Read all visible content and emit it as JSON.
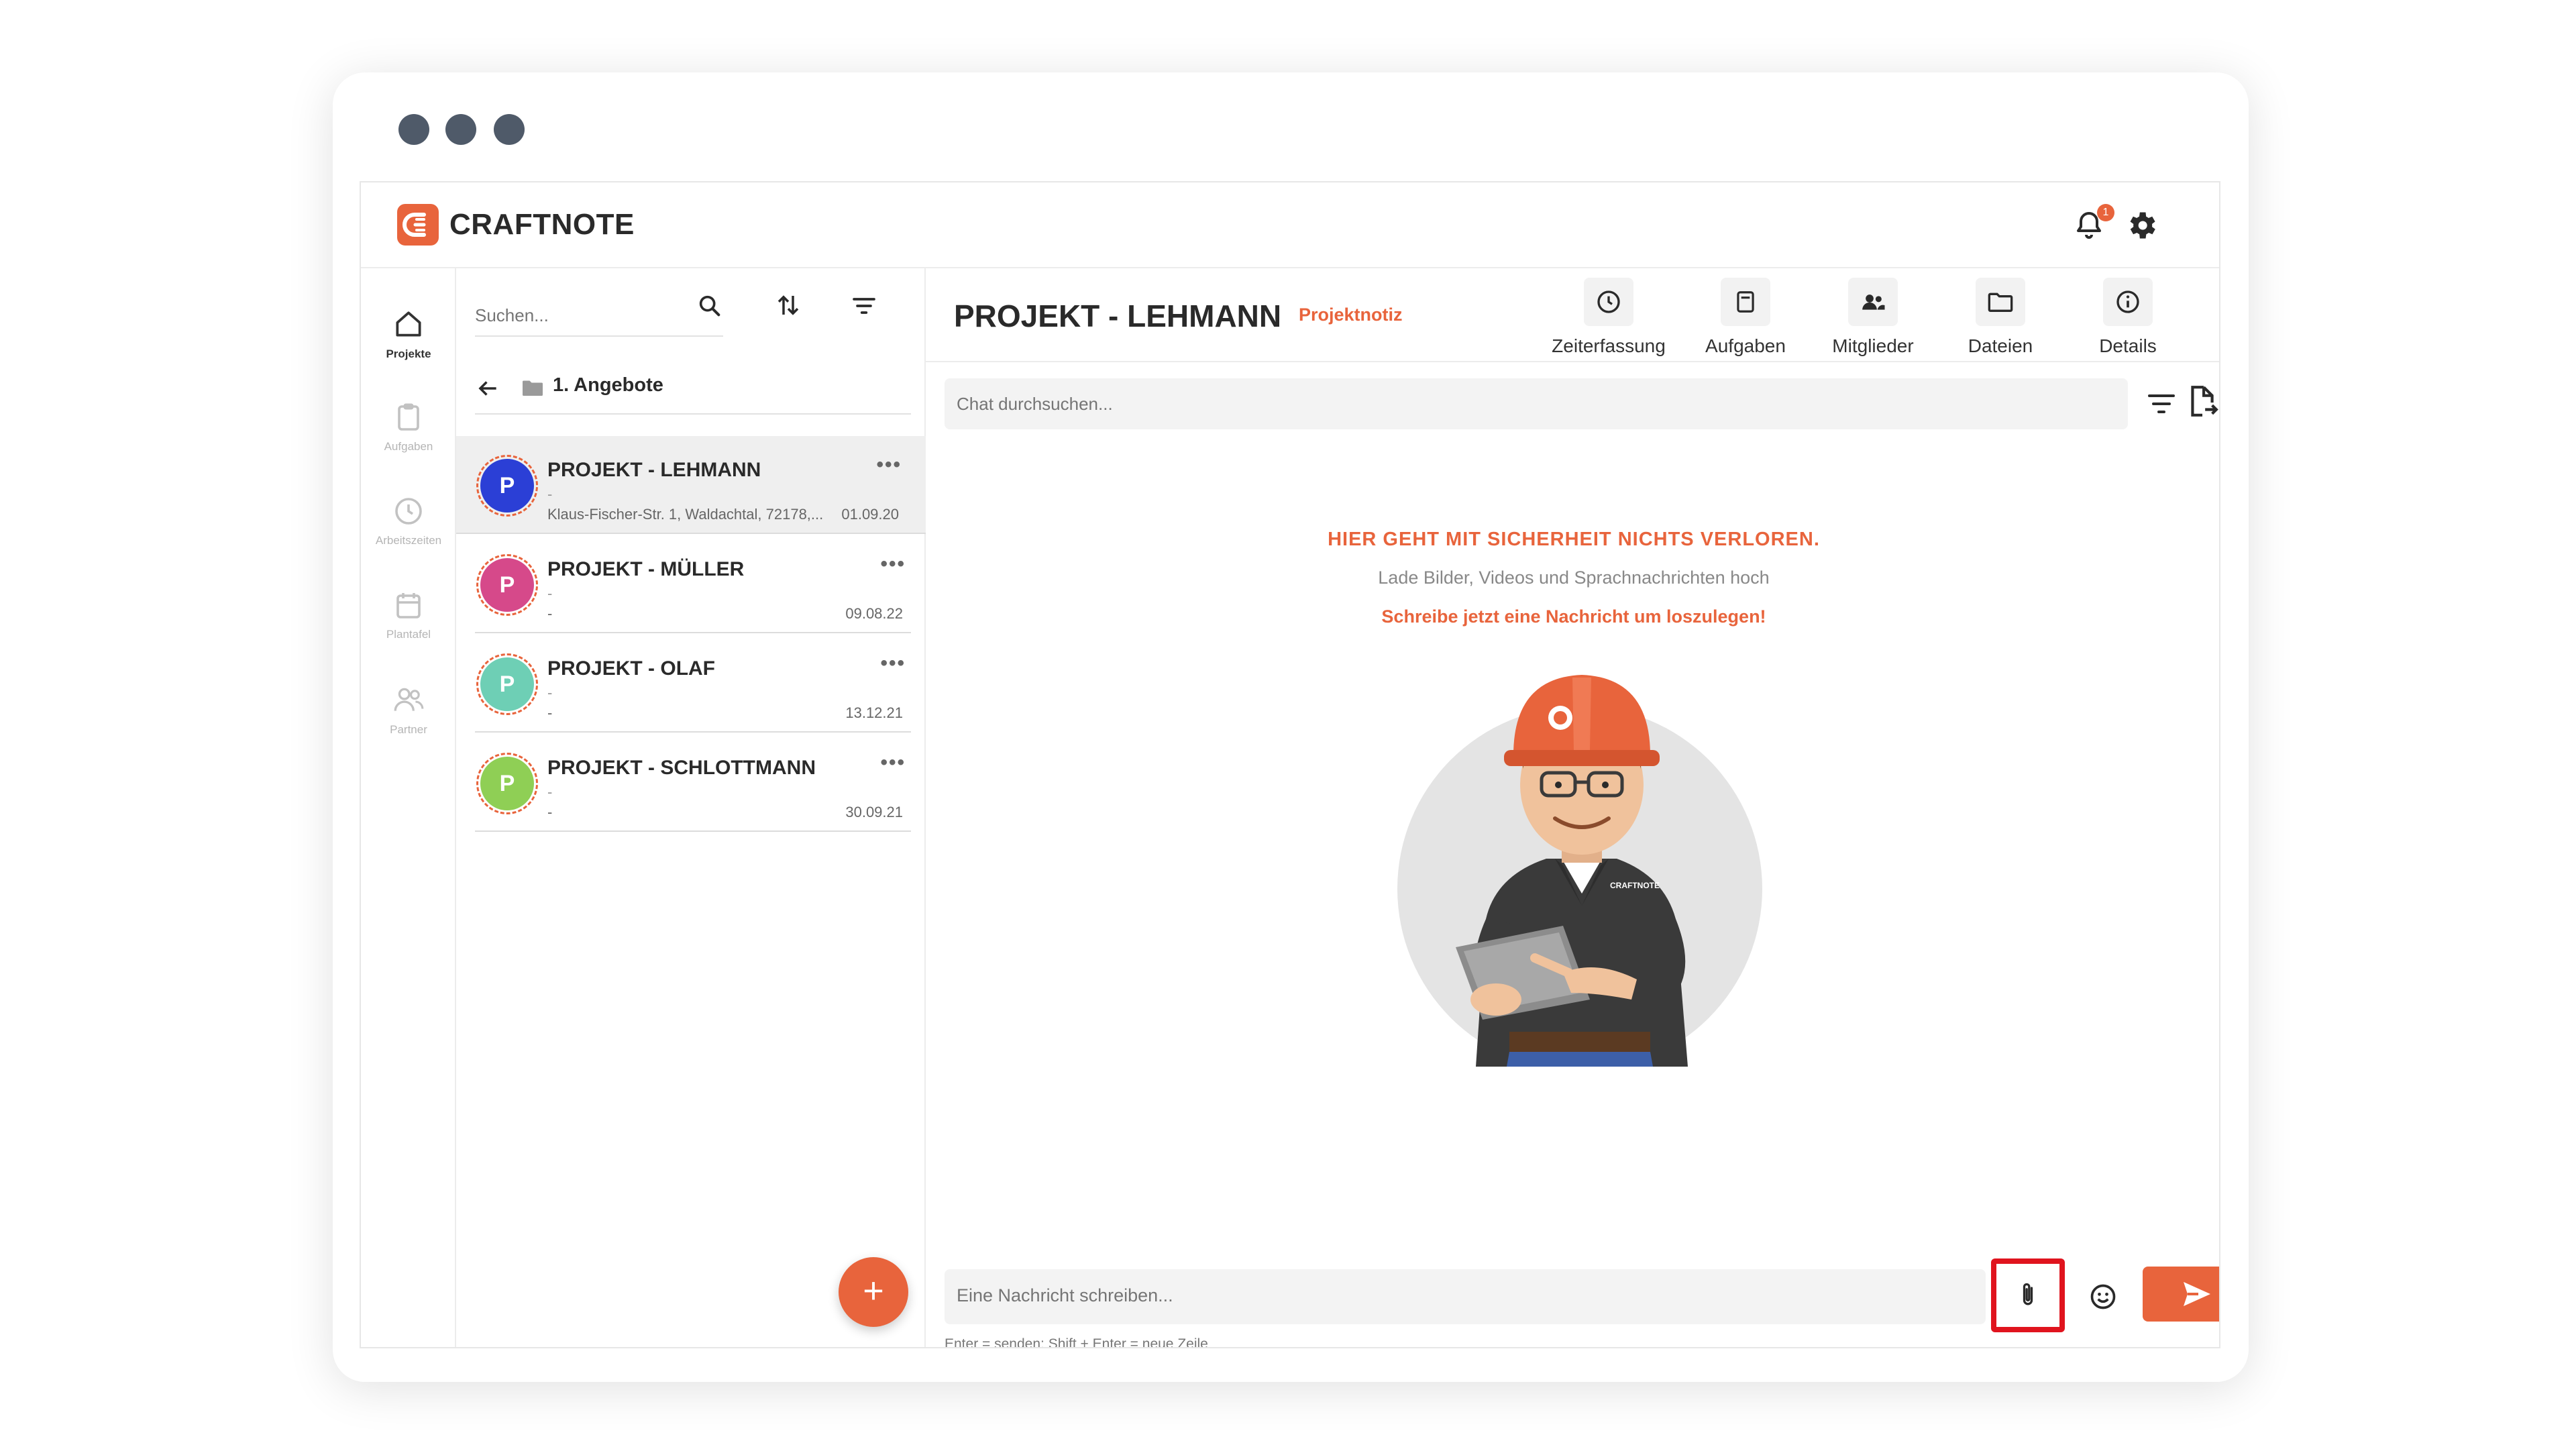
{
  "app": {
    "brand": "CRAFTNOTE",
    "accent_color": "#e8643c",
    "notification_count": "1"
  },
  "rail": {
    "items": [
      {
        "label": "Projekte",
        "icon": "home-icon",
        "active": true
      },
      {
        "label": "Aufgaben",
        "icon": "clipboard-icon",
        "active": false
      },
      {
        "label": "Arbeitszeiten",
        "icon": "clock-icon",
        "active": false
      },
      {
        "label": "Plantafel",
        "icon": "calendar-icon",
        "active": false
      },
      {
        "label": "Partner",
        "icon": "people-icon",
        "active": false
      }
    ]
  },
  "list": {
    "search_placeholder": "Suchen...",
    "folder_label": "1. Angebote",
    "projects": [
      {
        "initial": "P",
        "title": "PROJEKT - LEHMANN",
        "sub": "-",
        "address": "Klaus-Fischer-Str. 1, Waldachtal, 72178,...",
        "date": "01.09.20",
        "color": "#2b3fd6",
        "selected": true
      },
      {
        "initial": "P",
        "title": "PROJEKT - MÜLLER",
        "sub": "-",
        "address": "-",
        "date": "09.08.22",
        "color": "#d6498a",
        "selected": false
      },
      {
        "initial": "P",
        "title": "PROJEKT - OLAF",
        "sub": "-",
        "address": "-",
        "date": "13.12.21",
        "color": "#6ecfb5",
        "selected": false
      },
      {
        "initial": "P",
        "title": "PROJEKT - SCHLOTTMANN",
        "sub": "-",
        "address": "-",
        "date": "30.09.21",
        "color": "#8fcf55",
        "selected": false
      }
    ],
    "more_label": "•••",
    "fab_label": "+"
  },
  "chat": {
    "title": "PROJEKT - LEHMANN",
    "tag": "Projektnotiz",
    "header_buttons": [
      {
        "label": "Zeiterfassung",
        "icon": "clock-icon"
      },
      {
        "label": "Aufgaben",
        "icon": "task-icon"
      },
      {
        "label": "Mitglieder",
        "icon": "members-icon"
      },
      {
        "label": "Dateien",
        "icon": "folder-icon"
      },
      {
        "label": "Details",
        "icon": "info-icon"
      }
    ],
    "search_placeholder": "Chat durchsuchen...",
    "empty_title": "HIER GEHT MIT SICHERHEIT NICHTS VERLOREN.",
    "empty_sub": "Lade Bilder, Videos und Sprachnachrichten hoch",
    "empty_cta": "Schreibe jetzt eine Nachricht um loszulegen!",
    "illustration_label": "CRAFTNOTE",
    "composer_placeholder": "Eine Nachricht schreiben...",
    "hint": "Enter = senden; Shift + Enter = neue Zeile"
  }
}
